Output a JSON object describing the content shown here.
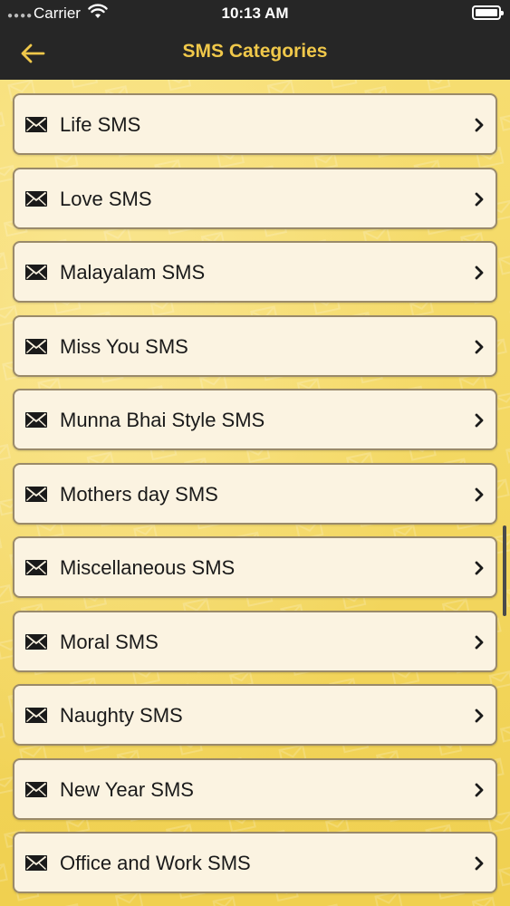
{
  "status_bar": {
    "carrier": "Carrier",
    "time": "10:13 AM",
    "icons": [
      "signal-dots-icon",
      "wifi-icon",
      "battery-icon"
    ]
  },
  "nav": {
    "title": "SMS Categories",
    "back_icon": "arrow-left-icon"
  },
  "colors": {
    "nav_bg": "#262626",
    "title": "#f0c84a",
    "background": "#f3d85c",
    "row_bg": "#fbf3e1"
  },
  "categories": [
    {
      "label": "Life SMS"
    },
    {
      "label": "Love SMS"
    },
    {
      "label": "Malayalam SMS"
    },
    {
      "label": "Miss You SMS"
    },
    {
      "label": "Munna Bhai Style SMS"
    },
    {
      "label": "Mothers day SMS"
    },
    {
      "label": "Miscellaneous SMS"
    },
    {
      "label": "Moral SMS"
    },
    {
      "label": "Naughty SMS"
    },
    {
      "label": "New Year SMS"
    },
    {
      "label": "Office and Work SMS"
    }
  ]
}
